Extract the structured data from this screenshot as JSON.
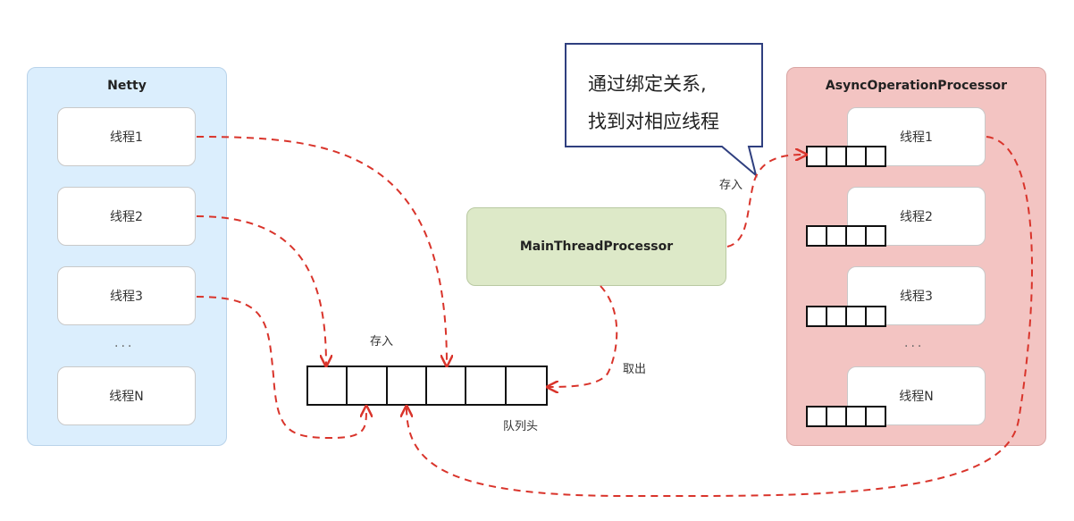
{
  "netty": {
    "title": "Netty",
    "threads": [
      "线程1",
      "线程2",
      "线程3",
      "线程N"
    ],
    "ellipsis": "···"
  },
  "async": {
    "title": "AsyncOperationProcessor",
    "threads": [
      "线程1",
      "线程2",
      "线程3",
      "线程N"
    ],
    "ellipsis": "···"
  },
  "main_processor": {
    "label": "MainThreadProcessor"
  },
  "queue": {
    "cells": 6,
    "head_label": "队列头",
    "store_label": "存入",
    "take_label": "取出"
  },
  "async_store_label": "存入",
  "callout": {
    "line1": "通过绑定关系,",
    "line2": "找到对相应线程"
  },
  "colors": {
    "arrow": "#d9342b",
    "netty_bg": "#dbeefd",
    "async_bg": "#f3c4c2",
    "main_bg": "#dde9c8",
    "callout_border": "#2f3f7f"
  }
}
